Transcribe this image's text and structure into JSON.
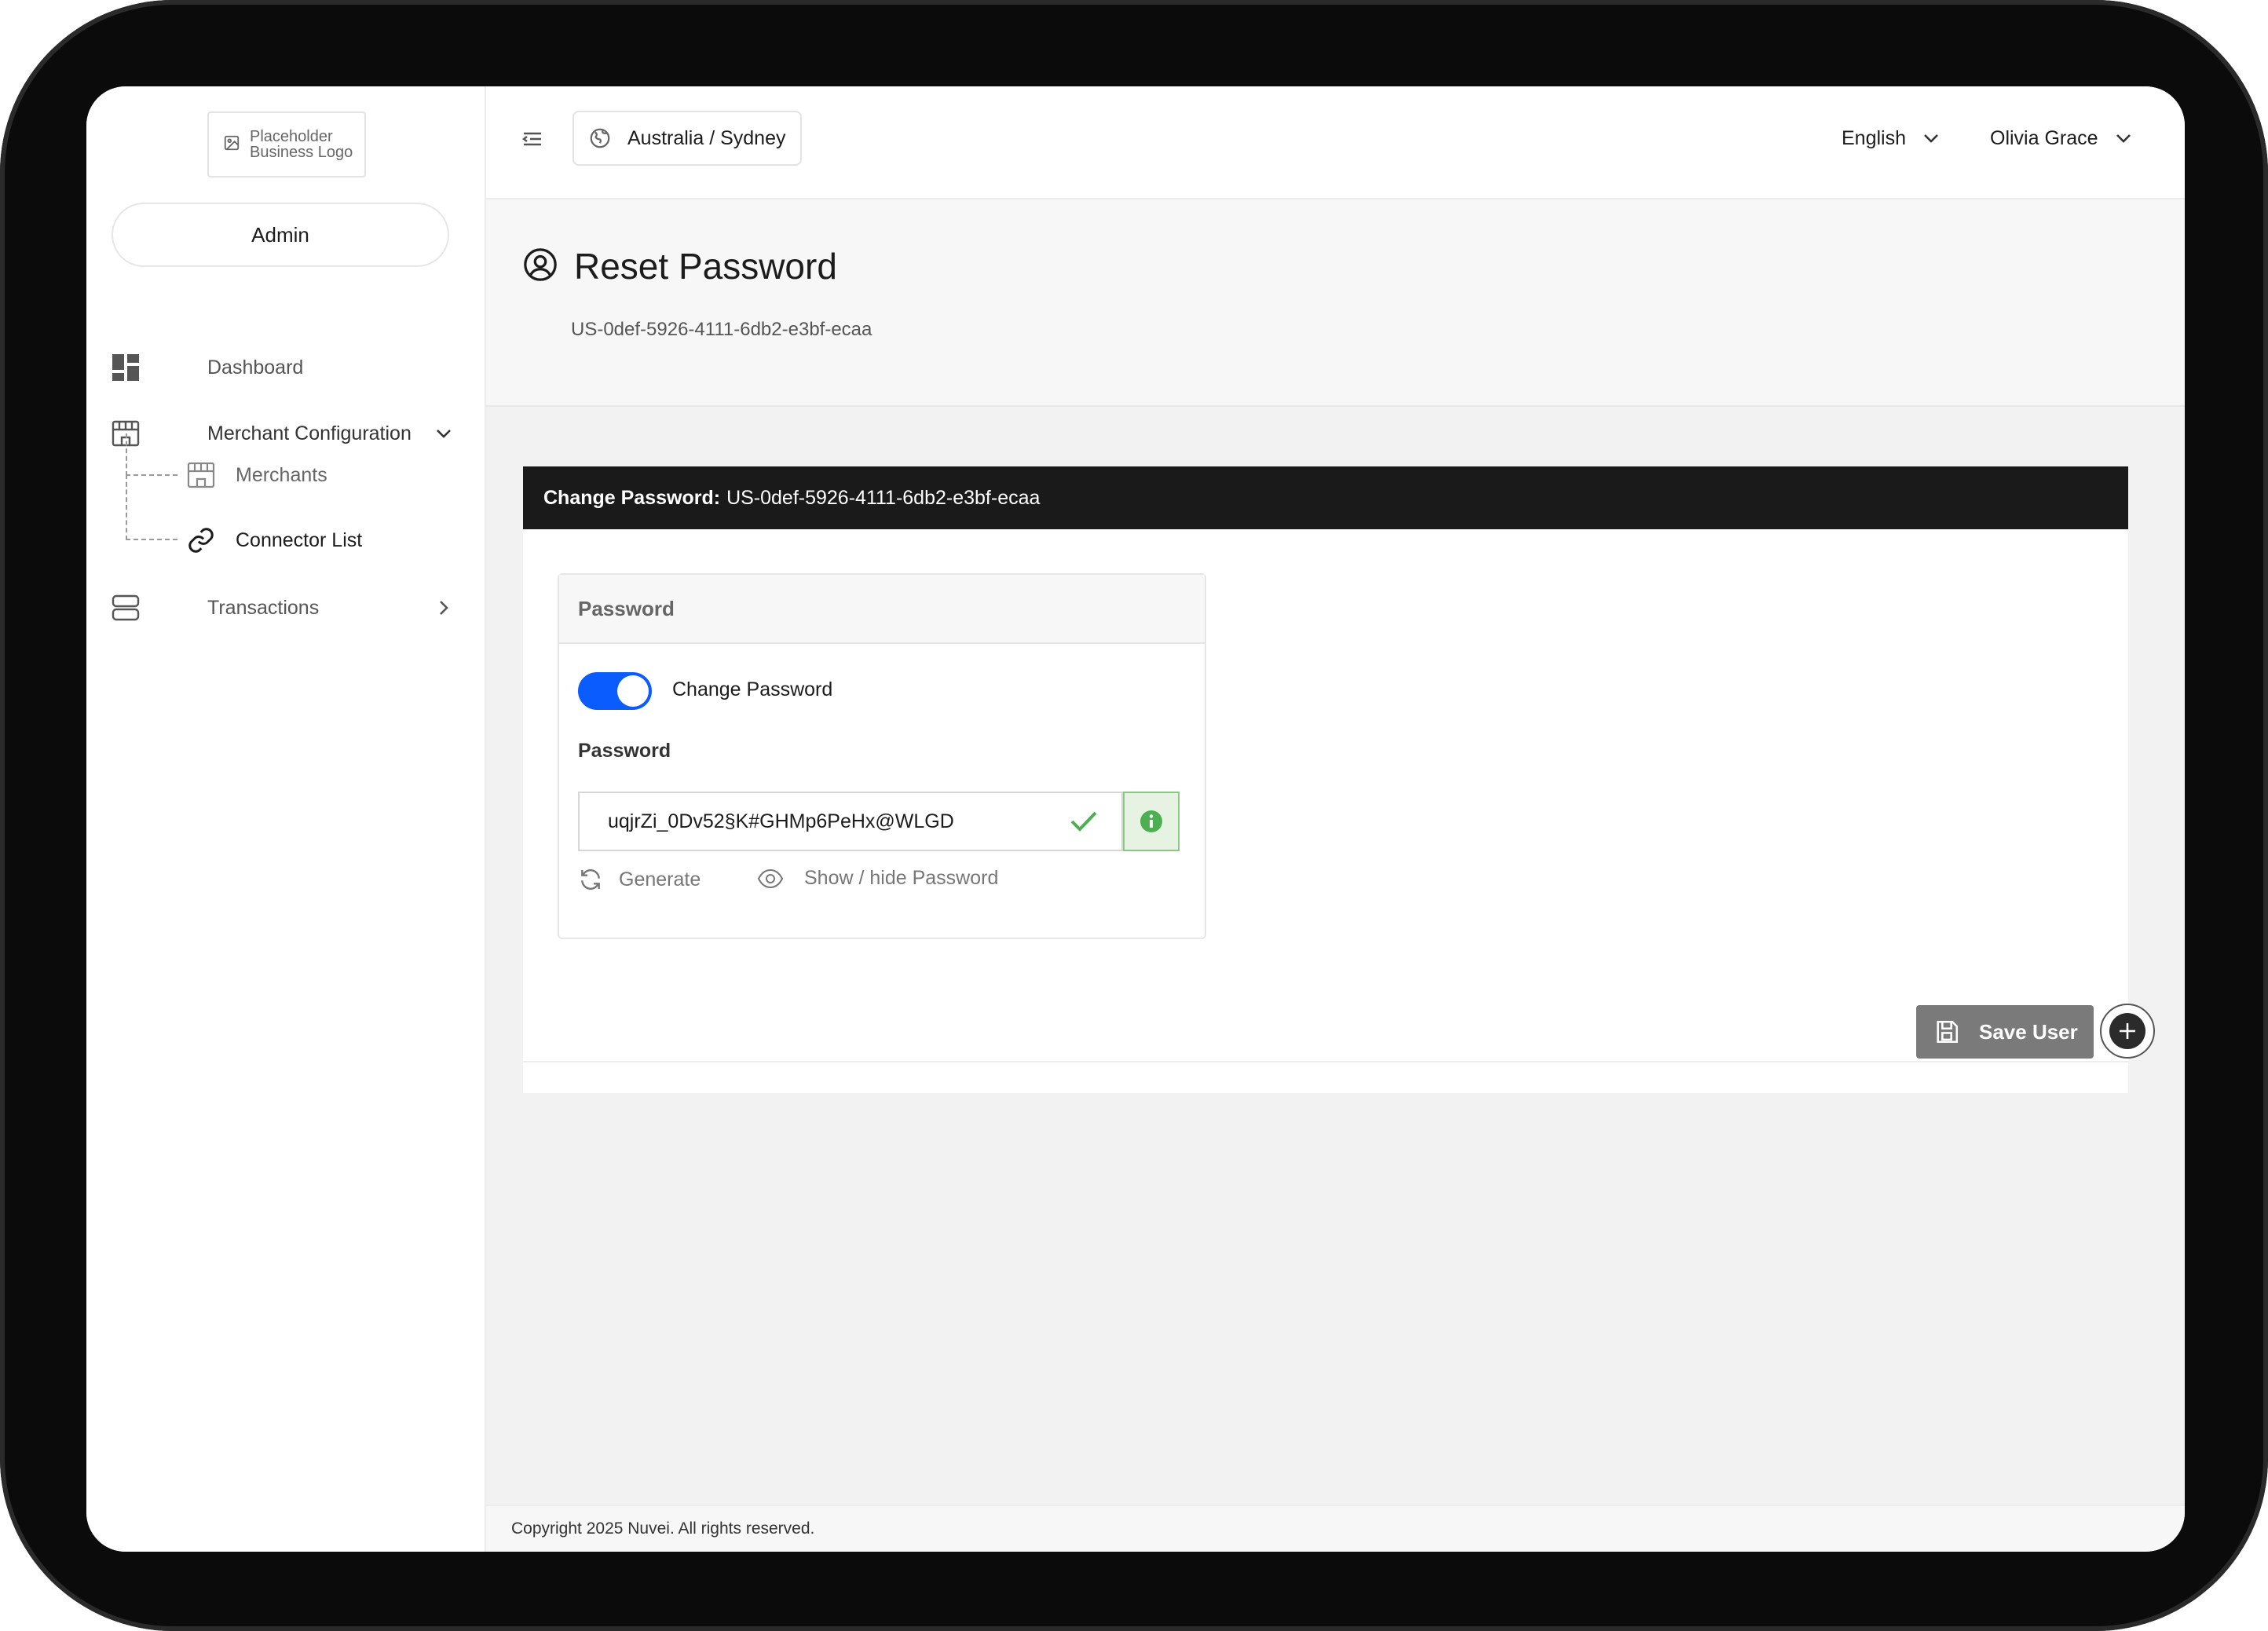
{
  "brand": {
    "logo_text": "Placeholder Business Logo",
    "logo_line1": "Placeholder",
    "logo_line2": "Business Logo"
  },
  "sidebar": {
    "role": "Admin",
    "items": [
      {
        "label": "Dashboard",
        "icon": "dashboard-icon"
      },
      {
        "label": "Merchant Configuration",
        "icon": "store-icon",
        "expanded": true
      },
      {
        "label": "Merchants",
        "icon": "store-icon"
      },
      {
        "label": "Connector List",
        "icon": "link-icon",
        "active": true
      },
      {
        "label": "Transactions",
        "icon": "server-icon"
      }
    ]
  },
  "header": {
    "timezone": "Australia / Sydney",
    "language": "English",
    "user_name": "Olivia Grace"
  },
  "page": {
    "title": "Reset Password",
    "subtitle": "US-0def-5926-4111-6db2-e3bf-ecaa"
  },
  "card": {
    "bar_label": "Change Password:",
    "bar_value": "US-0def-5926-4111-6db2-e3bf-ecaa",
    "panel_title": "Password",
    "toggle_label": "Change Password",
    "toggle_on": true,
    "field_label": "Password",
    "password_value": "uqjrZi_0Dv52§K#GHMp6PeHx@WLGD",
    "generate_label": "Generate",
    "show_hide_label": "Show / hide Password",
    "save_label": "Save User"
  },
  "footer": {
    "copyright": "Copyright 2025 Nuvei. All rights reserved."
  },
  "colors": {
    "accent": "#0a5cff",
    "valid": "#4caf50",
    "bar": "#1a1a1a",
    "save_button": "#7a7a7a"
  }
}
